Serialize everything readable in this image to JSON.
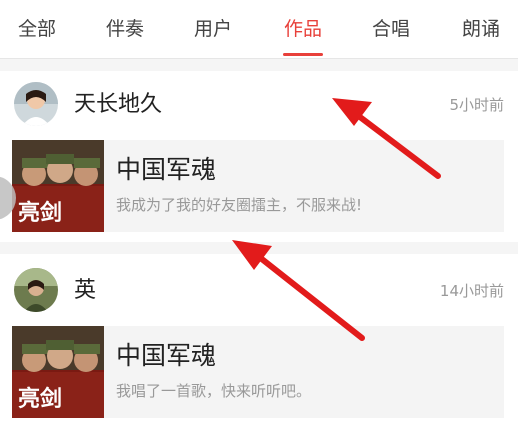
{
  "tabs": [
    {
      "label": "全部"
    },
    {
      "label": "伴奏"
    },
    {
      "label": "用户"
    },
    {
      "label": "作品",
      "active": true
    },
    {
      "label": "合唱"
    },
    {
      "label": "朗诵"
    }
  ],
  "posts": [
    {
      "username": "天长地久",
      "time": "5小时前",
      "song_title": "中国军魂",
      "desc": "我成为了我的好友圈擂主，不服来战!",
      "cover_text": "亮剑"
    },
    {
      "username": "英",
      "time": "14小时前",
      "song_title": "中国军魂",
      "desc": "我唱了一首歌，快来听听吧。",
      "cover_text": "亮剑"
    }
  ],
  "colors": {
    "accent": "#e8403a",
    "annotation": "#e21b1b"
  }
}
